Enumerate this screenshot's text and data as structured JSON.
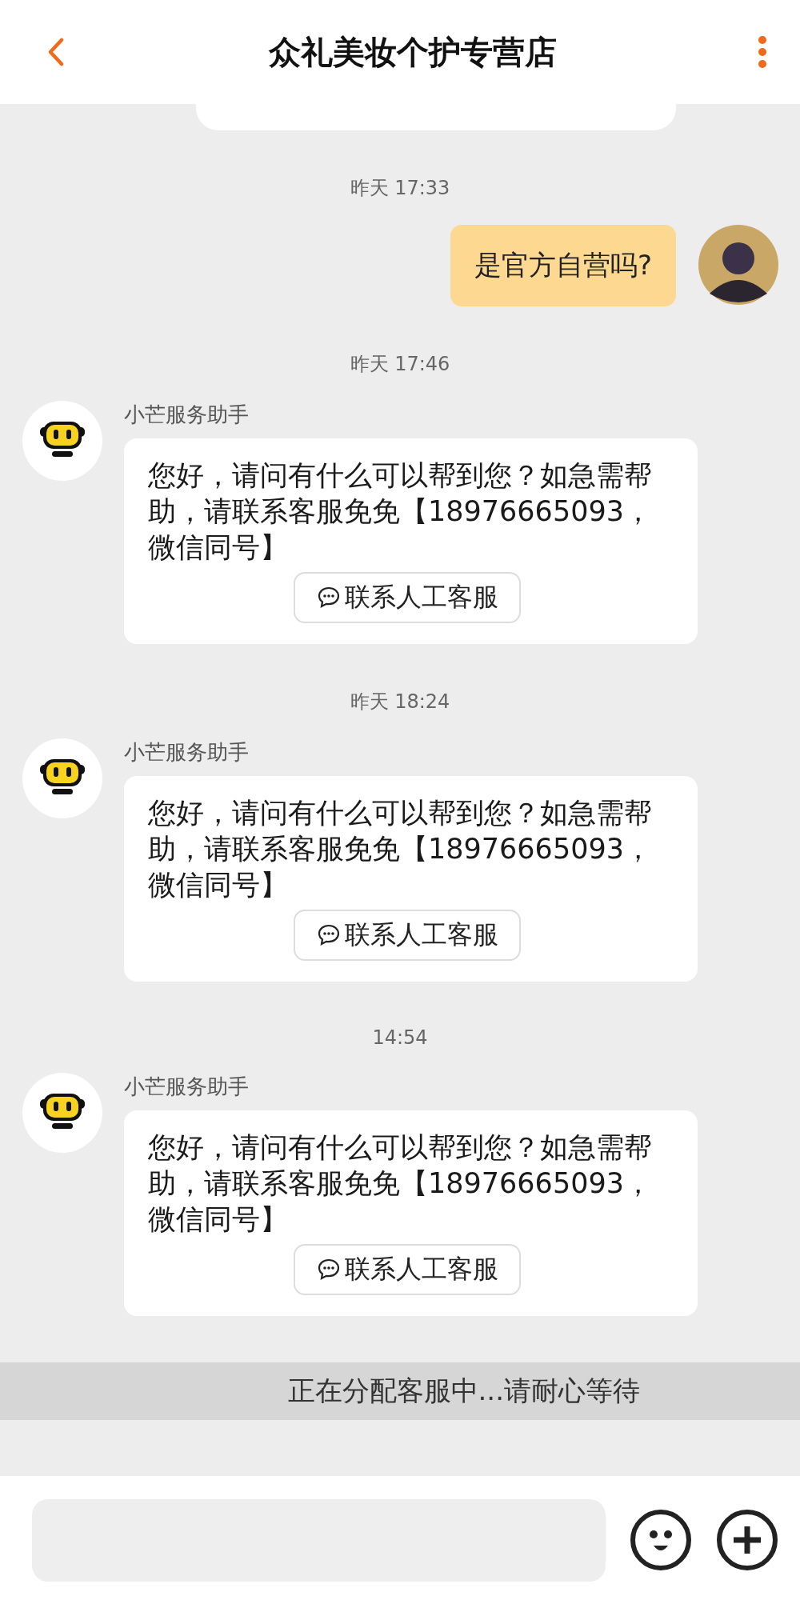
{
  "header": {
    "title": "众礼美妆个护专营店"
  },
  "messages": [
    {
      "kind": "partial"
    },
    {
      "kind": "time",
      "text": "昨天 17:33"
    },
    {
      "kind": "outgoing",
      "text": "是官方自营吗?"
    },
    {
      "kind": "time",
      "text": "昨天 17:46"
    },
    {
      "kind": "bot",
      "sender": "小芒服务助手",
      "text": "您好，请问有什么可以帮到您？如急需帮助，请联系客服免免【18976665093，微信同号】",
      "button": "联系人工客服"
    },
    {
      "kind": "time",
      "text": "昨天 18:24"
    },
    {
      "kind": "bot",
      "sender": "小芒服务助手",
      "text": "您好，请问有什么可以帮到您？如急需帮助，请联系客服免免【18976665093，微信同号】",
      "button": "联系人工客服"
    },
    {
      "kind": "time",
      "text": "14:54"
    },
    {
      "kind": "bot",
      "sender": "小芒服务助手",
      "text": "您好，请问有什么可以帮到您？如急需帮助，请联系客服免免【18976665093，微信同号】",
      "button": "联系人工客服"
    }
  ],
  "status_banner": "正在分配客服中...请耐心等待"
}
